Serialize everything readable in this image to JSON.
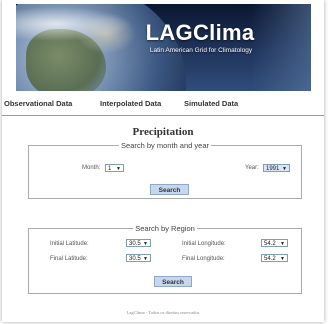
{
  "header": {
    "title": "LAGClima",
    "subtitle": "Latin American Grid for Climatology"
  },
  "nav": {
    "items": [
      "Observational Data",
      "Interpolated Data",
      "Simulated Data"
    ]
  },
  "page_title": "Precipitation",
  "search_month_year": {
    "legend": "Search by month and year",
    "month_label": "Month:",
    "month_value": "1",
    "year_label": "Year:",
    "year_value": "1991",
    "button": "Search"
  },
  "search_region": {
    "legend": "Search by Region",
    "initial_latitude_label": "Initial Latitude:",
    "initial_latitude_value": "30.5",
    "final_latitude_label": "Final Latitude:",
    "final_latitude_value": "30.5",
    "initial_longitude_label": "Initial Longitude:",
    "initial_longitude_value": "54.2",
    "final_longitude_label": "Final Longitude:",
    "final_longitude_value": "54.2",
    "button": "Search"
  },
  "footer": "LagClima - Todos os direitos reservados",
  "icons": {
    "dropdown": "chevron-down-icon"
  }
}
